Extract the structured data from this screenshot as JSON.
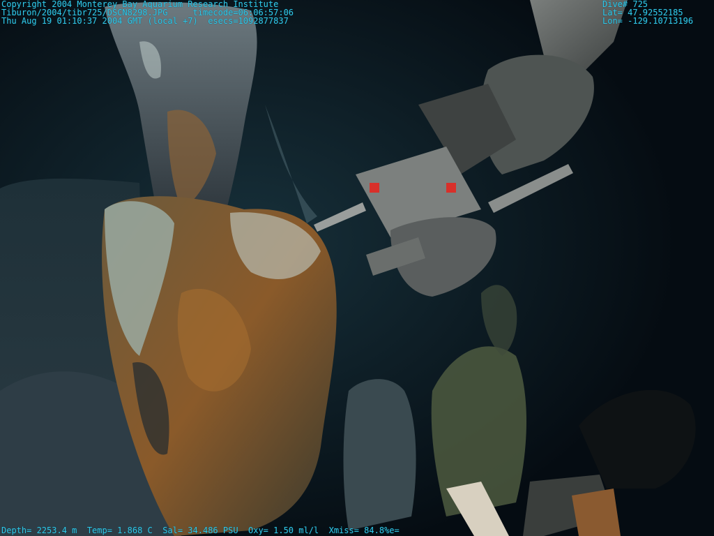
{
  "overlay": {
    "copyright": "Copyright 2004 Monterey Bay Aquarium Research Institute",
    "file_line": "Tiburon/2004/tibr725/DSCN8298.JPG     timecode=06:06:57:06",
    "date_line": "Thu Aug 19 01:10:37 2004 GMT (local +7)  esecs=1092877837",
    "dive": "Dive# 725",
    "lat": "Lat= 47.92552185",
    "lon": "Lon= -129.10713196",
    "sensors": "Depth= 2253.4 m  Temp= 1.868 C  Sal= 34.486 PSU  Oxy= 1.50 ml/l  Xmiss= 84.8%e="
  },
  "colors": {
    "overlay_text": "#30c8e8",
    "background": "#061018",
    "rock_dark": "#1c2a32",
    "rock_rust": "#8a5a2a",
    "mineral_white": "#b8cfc8",
    "arm_gray": "#5a5e5e"
  }
}
